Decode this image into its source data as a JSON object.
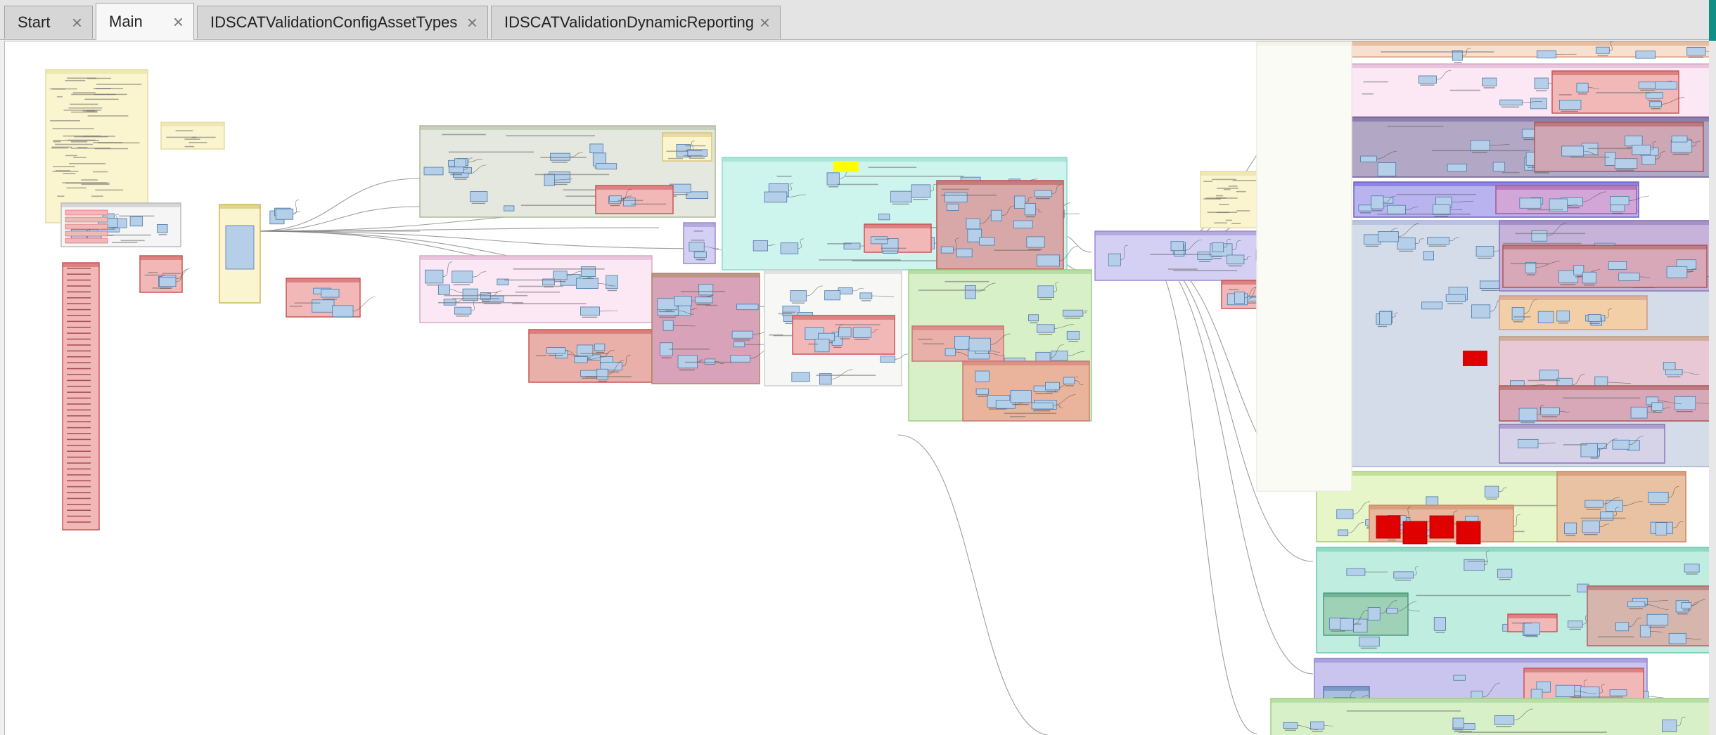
{
  "tabs": [
    {
      "label": "Start",
      "active": false
    },
    {
      "label": "Main",
      "active": true
    },
    {
      "label": "IDSCATValidationConfigAssetTypes",
      "active": false
    },
    {
      "label": "IDSCATValidationDynamicReporting",
      "active": false
    }
  ],
  "close_icon": "×",
  "colors": {
    "chrome_bg": "#e4e4e4",
    "tab_active": "#f7f7f7",
    "tab_inactive": "#d6d6d6",
    "canvas_bg": "#ffffff",
    "desktop_teal": "#0f8f86",
    "node_blue": "#b6cfe9",
    "bookmark_red": "#f2b8b8",
    "bookmark_green": "#d7f0c8",
    "bookmark_purple": "#d4d0f4",
    "bookmark_cyan": "#cdf5ee",
    "bookmark_yellow": "#fbf5cf",
    "bookmark_gray": "#e4e8de",
    "bookmark_pink": "#fbe8f4",
    "alert_red": "#e00000",
    "highlight_yellow": "#ffff00"
  }
}
